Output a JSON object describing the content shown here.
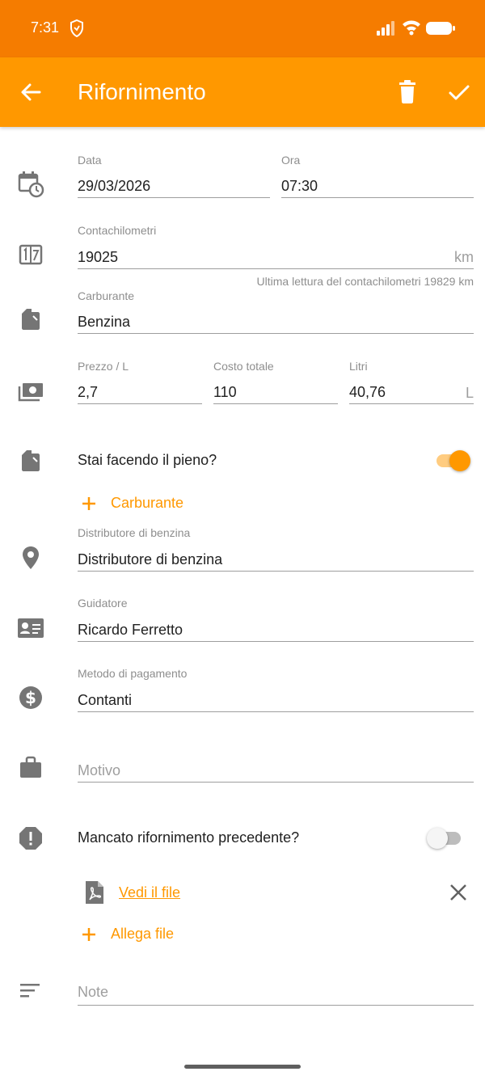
{
  "status_bar": {
    "time": "7:31",
    "icons": [
      "shield-icon",
      "signal-icon",
      "wifi-icon",
      "battery-icon"
    ],
    "color": "#f57c00"
  },
  "app_bar": {
    "title": "Rifornimento",
    "color": "#ff9800",
    "actions": [
      "back-arrow-icon",
      "delete-icon",
      "check-icon"
    ]
  },
  "form": {
    "date": {
      "label": "Data",
      "value": "29/03/2026"
    },
    "time": {
      "label": "Ora",
      "value": "07:30"
    },
    "odometer": {
      "label": "Contachilometri",
      "value": "19025",
      "suffix": "km",
      "helper": "Ultima lettura del contachilometri 19829 km"
    },
    "fuel": {
      "label": "Carburante",
      "value": "Benzina"
    },
    "price": {
      "label": "Prezzo / L",
      "value": "2,7"
    },
    "total_cost": {
      "label": "Costo totale",
      "value": "110"
    },
    "liters": {
      "label": "Litri",
      "value": "40,76",
      "suffix": "L"
    },
    "full_tank": {
      "label": "Stai facendo il pieno?",
      "checked": true
    },
    "add_fuel": {
      "label": "Carburante"
    },
    "station": {
      "label": "Distributore di benzina",
      "value": "Distributore di benzina"
    },
    "driver": {
      "label": "Guidatore",
      "value": "Ricardo Ferretto"
    },
    "payment": {
      "label": "Metodo di pagamento",
      "value": "Contanti"
    },
    "reason": {
      "placeholder": "Motivo"
    },
    "missed_refuel": {
      "label": "Mancato rifornimento precedente?",
      "checked": false
    },
    "attachment": {
      "label": "Vedi il file"
    },
    "attach_file": {
      "label": "Allega file"
    },
    "notes": {
      "placeholder": "Note"
    }
  },
  "colors": {
    "accent": "#ff9800",
    "icon_gray": "#757575",
    "underline": "#9e9e9e",
    "secondary_text": "#8e8e8e"
  }
}
